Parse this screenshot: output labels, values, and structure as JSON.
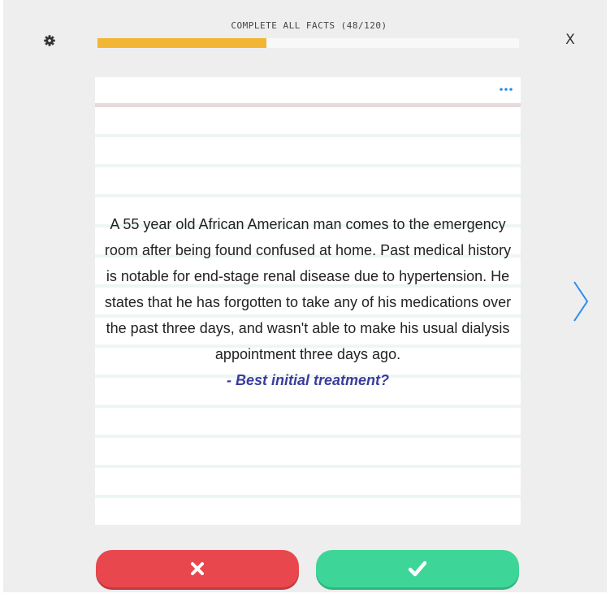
{
  "header": {
    "progress_label": "COMPLETE ALL FACTS (48/120)",
    "progress_fraction": 0.4
  },
  "icons": {
    "settings": "gear-icon",
    "close": "close-icon",
    "more": "ellipsis-icon",
    "next": "chevron-right-icon",
    "wrong": "x-mark-icon",
    "right": "check-mark-icon"
  },
  "close_label": "X",
  "card": {
    "text": "A 55 year old African American man comes to the emergency room after being found confused at home. Past medical history is notable for end-stage renal disease due to hypertension. He states that he has forgotten to take any of his medications over the past three days, and wasn't able to make his usual dialysis appointment three days ago.",
    "question": "- Best initial treatment?"
  },
  "colors": {
    "progress": "#f3b634",
    "wrong_button": "#e8474d",
    "right_button": "#3ed698",
    "question_text": "#3a3d9a",
    "accent": "#2d8cf0"
  }
}
